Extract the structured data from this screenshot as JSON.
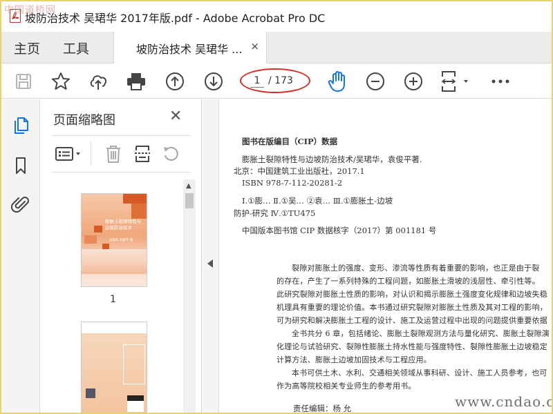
{
  "window": {
    "title": "坡防治技术 吴珺华 2017年版.pdf - Adobe Acrobat Pro DC",
    "watermark_top_left": "中国道桥网",
    "watermark_bottom_right": "www.cndao.com"
  },
  "tabs": {
    "home": "主页",
    "tools": "工具",
    "document": "坡防治技术 吴珺华 ...",
    "close_glyph": "×"
  },
  "toolbar": {
    "current_page": "1",
    "total_pages": "/ 173",
    "icons": [
      "save-icon",
      "bookmark-star-icon",
      "upload-cloud-icon",
      "print-icon",
      "page-up-icon",
      "page-down-icon",
      "hand-tool-icon",
      "zoom-out-icon",
      "zoom-in-icon",
      "fit-page-icon",
      "more-icon"
    ],
    "accent_color": "#1473e6",
    "annotation_color": "#d52a22"
  },
  "sidebar": {
    "panel_title": "页面缩略图",
    "close_glyph": "✕",
    "thumbnails": [
      {
        "label": "1",
        "cover_title": "膨胀土裂隙特性与边坡防治技术",
        "cover_author": "吴珺华 袁俊平 著"
      },
      {
        "label": ""
      }
    ]
  },
  "document": {
    "cip_heading": "图书在版编目（CIP）数据",
    "cip_lines": [
      "膨胀土裂隙特性与边坡防治技术/吴珺华，袁俊平著.",
      "北京：中国建筑工业出版社，2017.1",
      "ISBN 978-7-112-20281-2",
      "Ⅰ.①膨…  Ⅱ.①吴… ②袁…  Ⅲ.①膨胀土-边坡",
      "防护-研究  Ⅳ.①TU475",
      "中国版本图书馆 CIP 数据核字（2017）第 001181 号"
    ],
    "paragraphs": [
      "裂隙对膨胀土的强度、变形、渗流等性质有着重要的影响，也正是由于裂",
      "的存在，产生了一系列特殊的工程问题，如膨胀土滑坡的浅层性、牵引性等。",
      "此研究裂隙对膨胀土性质的影响，对认识和揭示膨胀土强度变化规律和边坡失稳",
      "机理具有重要的理论价值。本书通过研究裂隙对膨胀土性质及其对工程的影响，",
      "可为研究和解决膨胀土工程的设计、施工及运营过程中出现的问题提供重要依据",
      "全书共分 6 章，包括绪论、膨胀土裂隙观测方法与量化研究、膨胀土裂隙演",
      "化理论与试验研究、裂隙性膨胀土持水性能与强度特性、裂隙性膨胀土边坡稳定",
      "计算方法、膨胀土边坡加固技术与工程应用。",
      "本书可供土木、水利、交通相关领域从事科研、设计、施工人员参考，也可",
      "作为高等院校相关专业师生的参考用书。"
    ],
    "editor": "责任编辑：杨   允"
  }
}
